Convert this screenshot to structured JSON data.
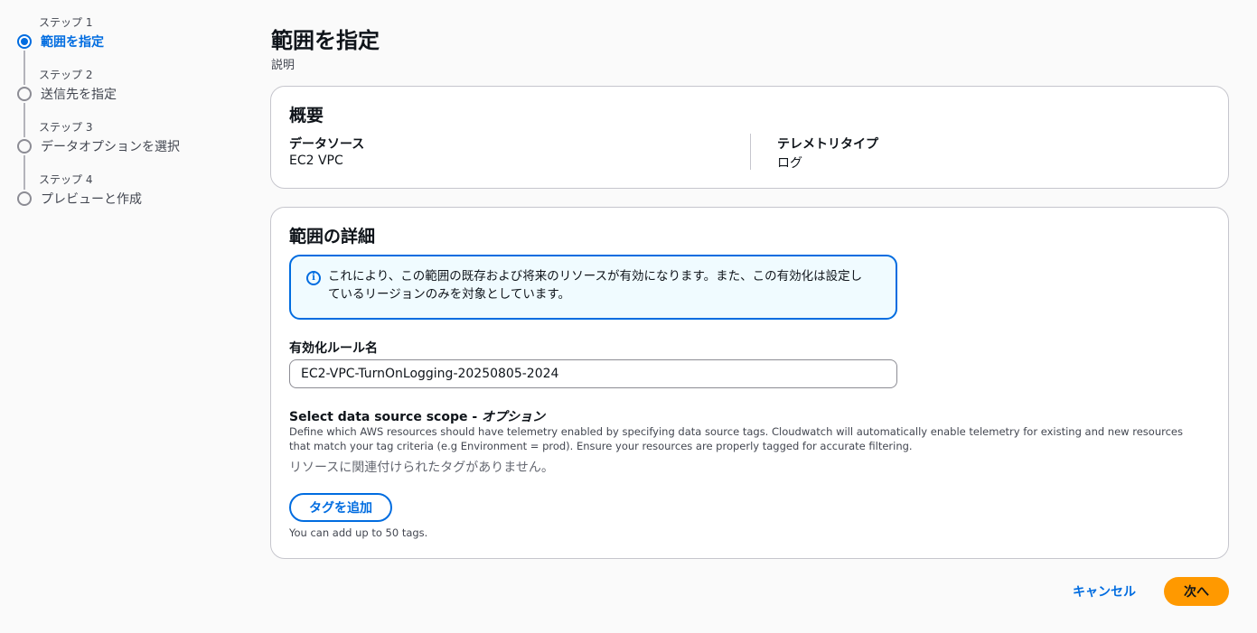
{
  "steps": [
    {
      "sub": "ステップ 1",
      "title": "範囲を指定",
      "active": true
    },
    {
      "sub": "ステップ 2",
      "title": "送信先を指定",
      "active": false
    },
    {
      "sub": "ステップ 3",
      "title": "データオプションを選択",
      "active": false
    },
    {
      "sub": "ステップ 4",
      "title": "プレビューと作成",
      "active": false
    }
  ],
  "page": {
    "title": "範囲を指定",
    "description": "説明"
  },
  "summary": {
    "title": "概要",
    "data_source_label": "データソース",
    "data_source_value": "EC2 VPC",
    "telemetry_type_label": "テレメトリタイプ",
    "telemetry_type_value": "ログ"
  },
  "details": {
    "title": "範囲の詳細",
    "info_icon": "info-icon",
    "info_text": "これにより、この範囲の既存および将来のリソースが有効になります。また、この有効化は設定しているリージョンのみを対象としています。",
    "rule_name_label": "有効化ルール名",
    "rule_name_value": "EC2-VPC-TurnOnLogging-20250805-2024",
    "scope_label": "Select data source scope - ",
    "scope_optional": "オプション",
    "scope_description": "Define which AWS resources should have telemetry enabled by specifying data source tags. Cloudwatch will automatically enable telemetry for existing and new resources that match your tag criteria (e.g Environment = prod). Ensure your resources are properly tagged for accurate filtering.",
    "empty_tags_text": "リソースに関連付けられたタグがありません。",
    "add_tag_label": "タグを追加",
    "tag_hint": "You can add up to 50 tags."
  },
  "footer": {
    "cancel_label": "キャンセル",
    "next_label": "次へ"
  },
  "colors": {
    "accent": "#006ce0",
    "primary_button": "#ff9900",
    "info_background": "#f0fbff"
  }
}
